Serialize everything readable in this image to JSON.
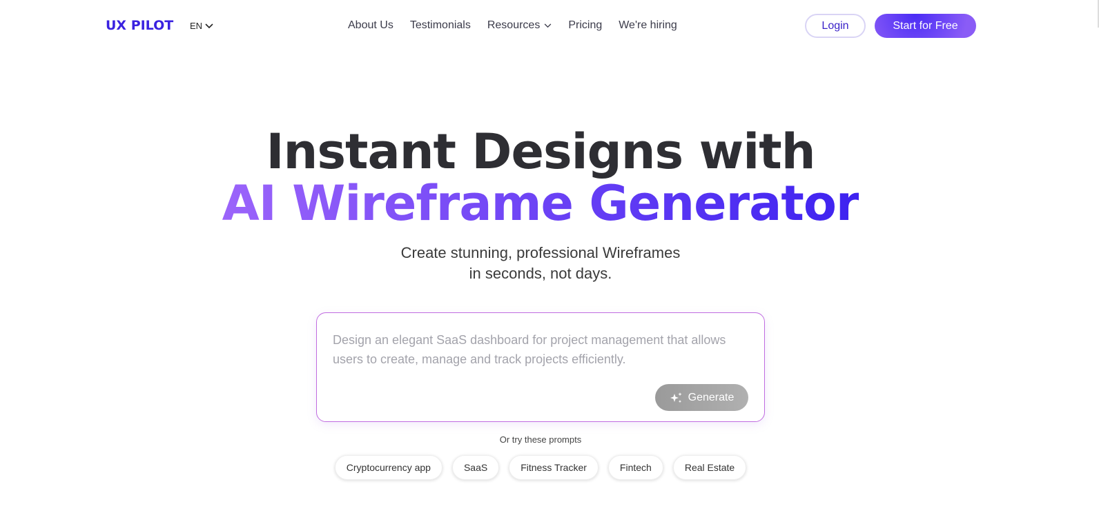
{
  "header": {
    "logo": "UX PILOT",
    "language": "EN",
    "nav": [
      "About Us",
      "Testimonials",
      "Resources",
      "Pricing",
      "We're hiring"
    ],
    "login": "Login",
    "start": "Start for Free"
  },
  "hero": {
    "title_line1": "Instant Designs with",
    "title_line2": "AI Wireframe Generator",
    "subtitle_line1": "Create stunning, professional Wireframes",
    "subtitle_line2": "in seconds, not days."
  },
  "prompt": {
    "placeholder": "Design an elegant SaaS dashboard for project management that allows users to create, manage and track projects efficiently.",
    "generate": "Generate"
  },
  "suggestions": {
    "label": "Or try these prompts",
    "items": [
      "Cryptocurrency app",
      "SaaS",
      "Fitness Tracker",
      "Fintech",
      "Real Estate"
    ]
  }
}
